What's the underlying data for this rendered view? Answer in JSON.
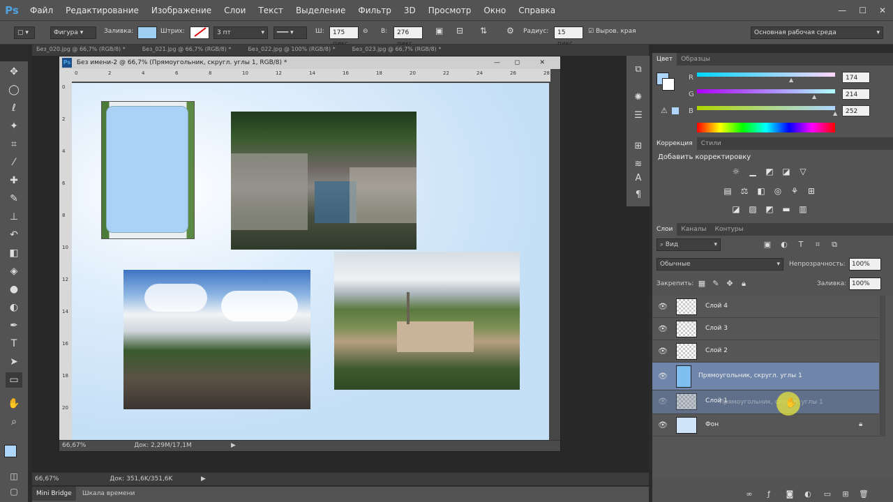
{
  "menubar": {
    "logo": "Ps",
    "items": [
      "Файл",
      "Редактирование",
      "Изображение",
      "Слои",
      "Текст",
      "Выделение",
      "Фильтр",
      "3D",
      "Просмотр",
      "Окно",
      "Справка"
    ],
    "min": "—",
    "max": "☐",
    "close": "✕"
  },
  "options": {
    "shape_mode": "Фигура",
    "fill_label": "Заливка:",
    "stroke_label": "Штрих:",
    "stroke_width": "3 пт",
    "w_label": "Ш:",
    "w_value": "175 пикс",
    "h_label": "В:",
    "h_value": "276 пикс",
    "radius_label": "Радиус:",
    "radius_value": "15 пикс",
    "align_edges": "Выров. края",
    "workspace": "Основная рабочая среда",
    "fill_color": "#9ecff3"
  },
  "doc_tabs": [
    "Без_020.jpg @ 66,7% (RGB/8) *",
    "Без_021.jpg @ 66,7% (RGB/8) *",
    "Без_022.jpg @ 100% (RGB/8) *",
    "Без_023.jpg @ 66,7% (RGB/8) *"
  ],
  "document": {
    "title": "Без имени-2 @ 66,7% (Прямоугольник, скругл. углы 1, RGB/8) *",
    "zoom": "66,67%",
    "doc_info": "Док: 2,29M/17,1M",
    "ruler_top": [
      "0",
      "2",
      "4",
      "6",
      "8",
      "10",
      "12",
      "14",
      "16",
      "18",
      "20",
      "22",
      "24",
      "26",
      "28"
    ],
    "ruler_left": [
      "0",
      "2",
      "4",
      "6",
      "8",
      "10",
      "12",
      "14",
      "16",
      "18",
      "20"
    ]
  },
  "main_status": {
    "zoom": "66,67%",
    "doc_info": "Док: 351,6K/351,6K"
  },
  "bottom_tabs": [
    "Mini Bridge",
    "Шкала времени"
  ],
  "color_panel": {
    "tabs": [
      "Цвет",
      "Образцы"
    ],
    "channels": [
      {
        "label": "R",
        "value": "174"
      },
      {
        "label": "G",
        "value": "214"
      },
      {
        "label": "B",
        "value": "252"
      }
    ],
    "fg_color": "#aed6fc"
  },
  "adjustments": {
    "tabs": [
      "Коррекция",
      "Стили"
    ],
    "title": "Добавить корректировку"
  },
  "layers_panel": {
    "tabs": [
      "Слои",
      "Каналы",
      "Контуры"
    ],
    "filter": "Вид",
    "blend": "Обычные",
    "opacity_label": "Непрозрачность:",
    "opacity": "100%",
    "lock_label": "Закрепить:",
    "fill_label": "Заливка:",
    "fill": "100%",
    "layers": [
      {
        "name": "Слой 4",
        "selected": false
      },
      {
        "name": "Слой 3",
        "selected": false
      },
      {
        "name": "Слой 2",
        "selected": false
      },
      {
        "name": "Прямоугольник, скругл. углы 1",
        "selected": true
      },
      {
        "name": "Слой 1",
        "selected": false
      },
      {
        "name": "Фон",
        "selected": false
      }
    ],
    "drag_ghost": "Прямоугольник, скругл. углы 1"
  }
}
